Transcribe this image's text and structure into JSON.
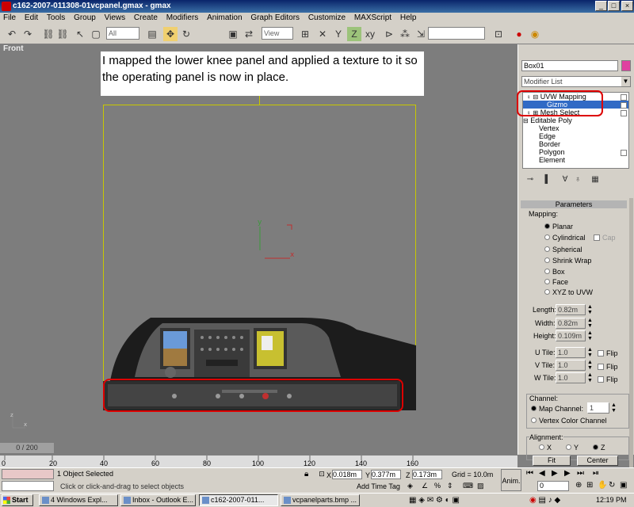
{
  "window": {
    "title": "c162-2007-011308-01vcpanel.gmax - gmax",
    "min": "_",
    "max": "□",
    "close": "×"
  },
  "menu": [
    "File",
    "Edit",
    "Tools",
    "Group",
    "Views",
    "Create",
    "Modifiers",
    "Animation",
    "Graph Editors",
    "Customize",
    "MAXScript",
    "Help"
  ],
  "toolbar": {
    "selection_filter": "All",
    "coord_system": "View"
  },
  "viewport": {
    "label": "Front",
    "note": "I mapped the lower knee panel and applied a texture to it so the operating panel is now in place."
  },
  "cmdpanel": {
    "object_name": "Box01",
    "modifier_list": "Modifier List",
    "stack": [
      "UVW Mapping",
      "Gizmo",
      "Mesh Select",
      "Editable Poly",
      "Vertex",
      "Edge",
      "Border",
      "Polygon",
      "Element"
    ],
    "params_title": "Parameters",
    "mapping_label": "Mapping:",
    "mapping_types": [
      "Planar",
      "Cylindrical",
      "Spherical",
      "Shrink Wrap",
      "Box",
      "Face",
      "XYZ to UVW"
    ],
    "cap_label": "Cap",
    "length_label": "Length:",
    "length": "0.82m",
    "width_label": "Width:",
    "width": "0.82m",
    "height_label": "Height:",
    "height": "0.109m",
    "utile_label": "U Tile:",
    "utile": "1.0",
    "vtile_label": "V Tile:",
    "vtile": "1.0",
    "wtile_label": "W Tile:",
    "wtile": "1.0",
    "flip_label": "Flip",
    "channel_label": "Channel:",
    "map_channel_label": "Map Channel:",
    "map_channel": "1",
    "vertex_color_label": "Vertex Color Channel",
    "alignment_label": "Alignment:",
    "align_x": "X",
    "align_y": "Y",
    "align_z": "Z",
    "fit": "Fit",
    "center": "Center"
  },
  "timeline": {
    "slider": "0 / 200",
    "ticks": [
      "0",
      "20",
      "40",
      "60",
      "80",
      "100",
      "120",
      "140",
      "160"
    ]
  },
  "status": {
    "selected": "1 Object Selected",
    "prompt": "Click or click-and-drag to select objects",
    "x_label": "X",
    "x": "0.018m",
    "y_label": "Y",
    "y": "0.377m",
    "z_label": "Z",
    "z": "0.173m",
    "grid": "Grid = 10.0m",
    "add_time_tag": "Add Time Tag",
    "anim": "Anim.",
    "frame": "0"
  },
  "taskbar": {
    "start": "Start",
    "tasks": [
      "4 Windows Expl...",
      "Inbox - Outlook E...",
      "c162-2007-011...",
      "vcpanelparts.bmp ..."
    ],
    "clock": "12:19 PM"
  },
  "colors": {
    "title_bar": "#0a246a",
    "highlight_stack": "#316ac5",
    "annotation_red": "#dd0000",
    "camera_yellow": "#c8c800"
  }
}
